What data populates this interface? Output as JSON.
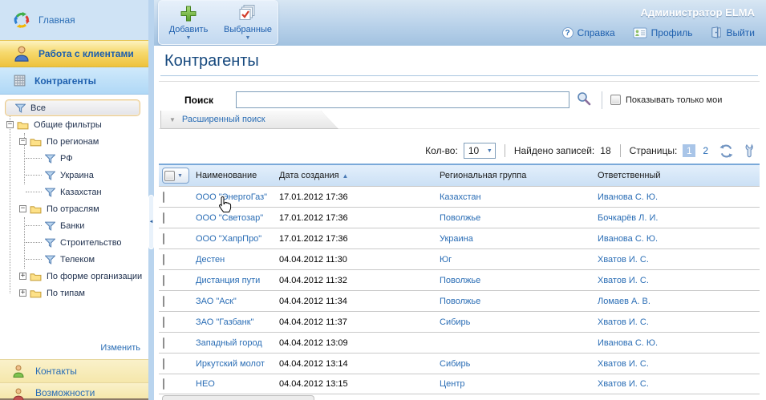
{
  "app": {
    "user": "Администратор ELMA"
  },
  "header": {
    "help": "Справка",
    "profile": "Профиль",
    "logout": "Выйти"
  },
  "toolbar": {
    "add": "Добавить",
    "selected": "Выбранные"
  },
  "sidebar": {
    "home": "Главная",
    "work_with_clients": "Работа с клиентами",
    "counterparties": "Контрагенты",
    "contacts": "Контакты",
    "opportunities": "Возможности",
    "edit": "Изменить",
    "tree": [
      {
        "label": "Все",
        "icon": "funnel-icon",
        "level": 0,
        "selected": true
      },
      {
        "label": "Общие фильтры",
        "icon": "folder-icon",
        "toggle": "minus",
        "level": 0
      },
      {
        "label": "По регионам",
        "icon": "folder-icon",
        "toggle": "minus",
        "level": 1
      },
      {
        "label": "РФ",
        "icon": "funnel-icon",
        "level": 2
      },
      {
        "label": "Украина",
        "icon": "funnel-icon",
        "level": 2
      },
      {
        "label": "Казахстан",
        "icon": "funnel-icon",
        "level": 2
      },
      {
        "label": "По отраслям",
        "icon": "folder-icon",
        "toggle": "minus",
        "level": 1
      },
      {
        "label": "Банки",
        "icon": "funnel-icon",
        "level": 2
      },
      {
        "label": "Строительство",
        "icon": "funnel-icon",
        "level": 2
      },
      {
        "label": "Телеком",
        "icon": "funnel-icon",
        "level": 2
      },
      {
        "label": "По форме организации",
        "icon": "folder-icon",
        "toggle": "plus",
        "level": 1
      },
      {
        "label": "По типам",
        "icon": "folder-icon",
        "toggle": "plus",
        "level": 1
      }
    ]
  },
  "page": {
    "title": "Контрагенты"
  },
  "search": {
    "label": "Поиск",
    "value": "",
    "only_mine": "Показывать только мои",
    "advanced": "Расширенный поиск"
  },
  "controls": {
    "count_label": "Кол-во:",
    "count_value": "10",
    "found_label": "Найдено записей:",
    "found_value": "18",
    "pages_label": "Страницы:",
    "page1": "1",
    "page2": "2"
  },
  "table": {
    "headers": {
      "name": "Наименование",
      "date": "Дата создания",
      "region": "Региональная группа",
      "responsible": "Ответственный"
    },
    "sort": {
      "column": "Дата создания",
      "direction": "asc"
    },
    "rows": [
      {
        "name": "ООО \"ЭнергоГаз\"",
        "date": "17.01.2012 17:36",
        "region": "Казахстан",
        "responsible": "Иванова С. Ю."
      },
      {
        "name": "ООО \"Светозар\"",
        "date": "17.01.2012 17:36",
        "region": "Поволжье",
        "responsible": "Бочкарёв Л. И."
      },
      {
        "name": "ООО \"ХапрПро\"",
        "date": "17.01.2012 17:36",
        "region": "Украина",
        "responsible": "Иванова С. Ю."
      },
      {
        "name": "Дестен",
        "date": "04.04.2012 11:30",
        "region": "Юг",
        "responsible": "Хватов И. С."
      },
      {
        "name": "Дистанция пути",
        "date": "04.04.2012 11:32",
        "region": "Поволжье",
        "responsible": "Хватов И. С."
      },
      {
        "name": "ЗАО \"Аск\"",
        "date": "04.04.2012 11:34",
        "region": "Поволжье",
        "responsible": "Ломаев А. В."
      },
      {
        "name": "ЗАО \"Газбанк\"",
        "date": "04.04.2012 11:37",
        "region": "Сибирь",
        "responsible": "Хватов И. С."
      },
      {
        "name": "Западный город",
        "date": "04.04.2012 13:09",
        "region": "",
        "responsible": "Иванова С. Ю."
      },
      {
        "name": "Иркутский молот",
        "date": "04.04.2012 13:14",
        "region": "Сибирь",
        "responsible": "Хватов И. С."
      },
      {
        "name": "НЕО",
        "date": "04.04.2012 13:15",
        "region": "Центр",
        "responsible": "Хватов И. С."
      }
    ]
  },
  "colors": {
    "accent_link": "#2a6db5",
    "nav_selected_yellow": "#eec23c",
    "nav_active_blue": "#b0d8f6",
    "page_selected_bg": "#a9c5e8",
    "table_header_top_border": "#7aa9d9"
  }
}
